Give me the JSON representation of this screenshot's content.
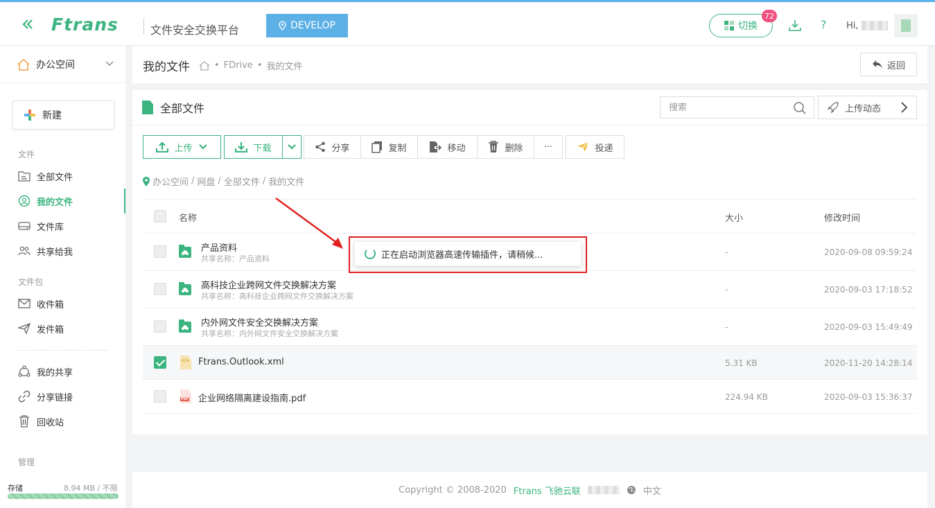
{
  "header": {
    "logo": "Ftrans",
    "platform": "文件安全交换平台",
    "env_badge": "DEVELOP",
    "switch_label": "切换",
    "switch_badge": "72",
    "help": "?",
    "greeting": "Hi,"
  },
  "sidebar": {
    "workspace": "办公空间",
    "new_label": "新建",
    "section_files": "文件",
    "section_pkg": "文件包",
    "section_admin": "管理",
    "items": [
      {
        "label": "全部文件"
      },
      {
        "label": "我的文件"
      },
      {
        "label": "文件库"
      },
      {
        "label": "共享给我"
      },
      {
        "label": "收件箱"
      },
      {
        "label": "发件箱"
      },
      {
        "label": "我的共享"
      },
      {
        "label": "分享链接"
      },
      {
        "label": "回收站"
      }
    ],
    "storage_label": "存储",
    "storage_value": "8.94 MB / 不限"
  },
  "page": {
    "title": "我的文件",
    "breadcrumb": [
      "FDrive",
      "我的文件"
    ],
    "return_label": "返回"
  },
  "main": {
    "card_title": "全部文件",
    "search_placeholder": "搜索",
    "upload_dynamics": "上传动态",
    "toolbar": {
      "upload": "上传",
      "download": "下载",
      "share": "分享",
      "copy": "复制",
      "move": "移动",
      "delete": "删除",
      "more": "···",
      "deliver": "投递"
    },
    "path": [
      "办公空间",
      "网盘",
      "全部文件",
      "我的文件"
    ],
    "path_sep": "/",
    "columns": {
      "name": "名称",
      "size": "大小",
      "modified": "修改时间"
    },
    "rows": [
      {
        "name": "产品资料",
        "sub": "共享名称：产品资料",
        "size": "-",
        "date": "2020-09-08 09:59:24",
        "type": "folder",
        "checked": false
      },
      {
        "name": "高科技企业跨网文件交换解决方案",
        "sub": "共享名称：高科技企业跨网文件交换解决方案",
        "size": "-",
        "date": "2020-09-03 17:18:52",
        "type": "folder",
        "checked": false
      },
      {
        "name": "内外网文件安全交换解决方案",
        "sub": "共享名称：内外网文件安全交换解决方案",
        "size": "-",
        "date": "2020-09-03 15:49:49",
        "type": "folder",
        "checked": false
      },
      {
        "name": "Ftrans.Outlook.xml",
        "sub": "",
        "size": "5.31 KB",
        "date": "2020-11-20 14:28:14",
        "type": "xml",
        "checked": true
      },
      {
        "name": "企业网络隔离建设指南.pdf",
        "sub": "",
        "size": "224.94 KB",
        "date": "2020-09-03 15:36:37",
        "type": "pdf",
        "checked": false
      }
    ]
  },
  "toast": {
    "message": "正在启动浏览器高速传输插件，请稍候..."
  },
  "footer": {
    "copyright": "Copyright © 2008-2020",
    "brand": "Ftrans 飞驰云联",
    "lang": "中文"
  },
  "colors": {
    "accent": "#3cb480",
    "badge": "#5cb0e6",
    "alert": "#e0201e"
  }
}
